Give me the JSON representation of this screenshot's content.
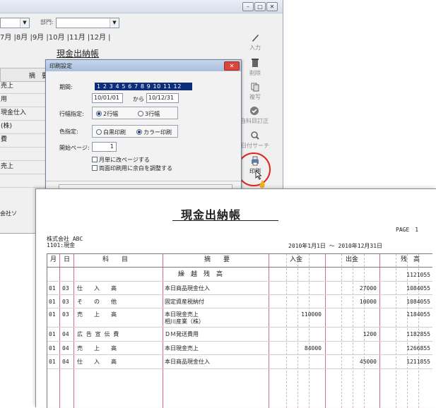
{
  "app": {
    "window_controls": [
      "–",
      "□",
      "✕"
    ],
    "dept_label": "部門:",
    "month_tabs": "7月 |8月 |9月 |10月 |11月 |12月 |",
    "heading": "現金出納帳",
    "col_header": "摘　要",
    "bg_rows": [
      "売上",
      "用",
      "現金仕入",
      "(株)",
      "費",
      "",
      "売上",
      "",
      "",
      "会社ソ"
    ]
  },
  "toolbar": {
    "input": "入力",
    "delete": "削除",
    "copy": "複写",
    "correction": "自科目訂正",
    "date_search": "日付サーチ",
    "print": "印刷"
  },
  "dialog": {
    "title": "印刷設定",
    "period_label": "期間:",
    "period_months": "1 2 3 4 5 6 7 8 9 10 11 12",
    "date_from": "10/01/01",
    "date_sep": "から",
    "date_to": "10/12/31",
    "row_label": "行幅指定:",
    "row_opt1": "2行幅",
    "row_opt2": "3行幅",
    "color_label": "色指定:",
    "color_opt1": "白黒印刷",
    "color_opt2": "カラー印刷",
    "start_page_label": "開始ページ:",
    "start_page": "1",
    "check1": "月単に改ページする",
    "check2": "両面印刷用に余白を調整する"
  },
  "preview": {
    "title": "現金出納帳",
    "page": "PAGE　1",
    "company": "株式会社 ABC",
    "account": "1101:現金",
    "period": "2010年1月1日 ～ 2010年12月31日",
    "headers": {
      "month": "月",
      "day": "日",
      "item": "科　　目",
      "memo": "摘　　要",
      "in": "入金",
      "out": "出金",
      "balance": "残　高"
    },
    "rows": [
      {
        "m": "",
        "d": "",
        "item": "",
        "memo": "繰　越　残　高",
        "memo2": "",
        "in": "",
        "out": "",
        "bal": "1121055"
      },
      {
        "m": "01",
        "d": "03",
        "item": "仕　　入　　高",
        "memo": "本日商品現金仕入",
        "memo2": "",
        "in": "",
        "out": "27000",
        "bal": "1084055"
      },
      {
        "m": "01",
        "d": "03",
        "item": "そ　　の　　他",
        "memo": "固定資産税納付",
        "memo2": "",
        "in": "",
        "out": "10000",
        "bal": "1084055"
      },
      {
        "m": "01",
        "d": "03",
        "item": "売　　上　　高",
        "memo": "本日現金売上",
        "memo2": "相川産業（株）",
        "in": "110000",
        "out": "",
        "bal": "1184055"
      },
      {
        "m": "01",
        "d": "04",
        "item": "広 告 宣 伝 費",
        "memo": "ＤＭ発送費用",
        "memo2": "",
        "in": "",
        "out": "1200",
        "bal": "1182855"
      },
      {
        "m": "01",
        "d": "04",
        "item": "売　　上　　高",
        "memo": "本日現金売上",
        "memo2": "",
        "in": "84000",
        "out": "",
        "bal": "1266855"
      },
      {
        "m": "01",
        "d": "04",
        "item": "仕　　入　　高",
        "memo": "本日商品現金仕入",
        "memo2": "",
        "in": "",
        "out": "45000",
        "bal": "1211855"
      }
    ]
  }
}
